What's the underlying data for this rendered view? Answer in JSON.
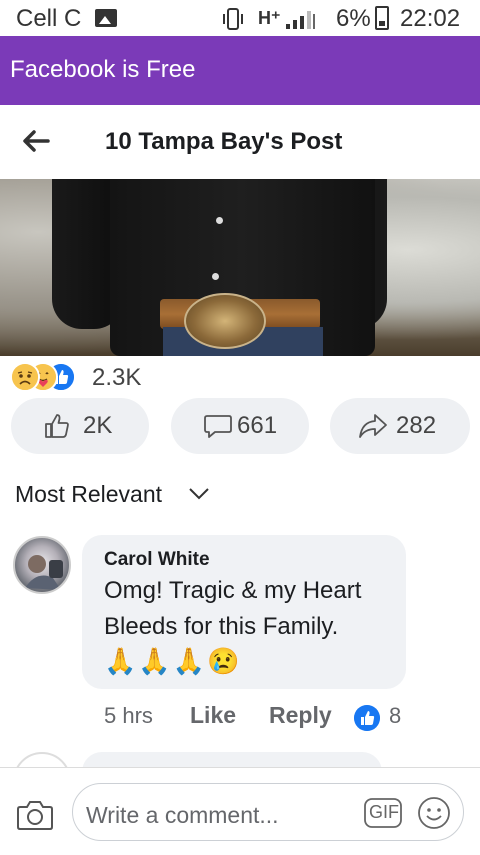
{
  "status_bar": {
    "carrier": "Cell C",
    "network_type": "H⁺",
    "battery_pct": "6%",
    "time": "22:02"
  },
  "promo_banner": {
    "text": "Facebook is Free",
    "color": "#7b3ab8"
  },
  "header": {
    "title": "10 Tampa Bay's Post",
    "back_icon": "arrow-left-icon"
  },
  "post": {
    "reactions": {
      "icons": [
        "sad-icon",
        "care-icon",
        "like-icon"
      ],
      "count": "2.3K"
    },
    "actions": {
      "like_count": "2K",
      "comment_count": "661",
      "share_count": "282"
    }
  },
  "comments": {
    "sort_label": "Most Relevant",
    "items": [
      {
        "author": "Carol White",
        "text": "Omg!  Tragic & my Heart Bleeds for this Family.",
        "emoji": "🙏🙏🙏😢",
        "time": "5 hrs",
        "like_label": "Like",
        "reply_label": "Reply",
        "like_count": "8"
      }
    ]
  },
  "composer": {
    "placeholder": "Write a comment...",
    "gif_label": "GIF"
  },
  "colors": {
    "accent": "#1877f2",
    "banner": "#7b3ab8"
  }
}
